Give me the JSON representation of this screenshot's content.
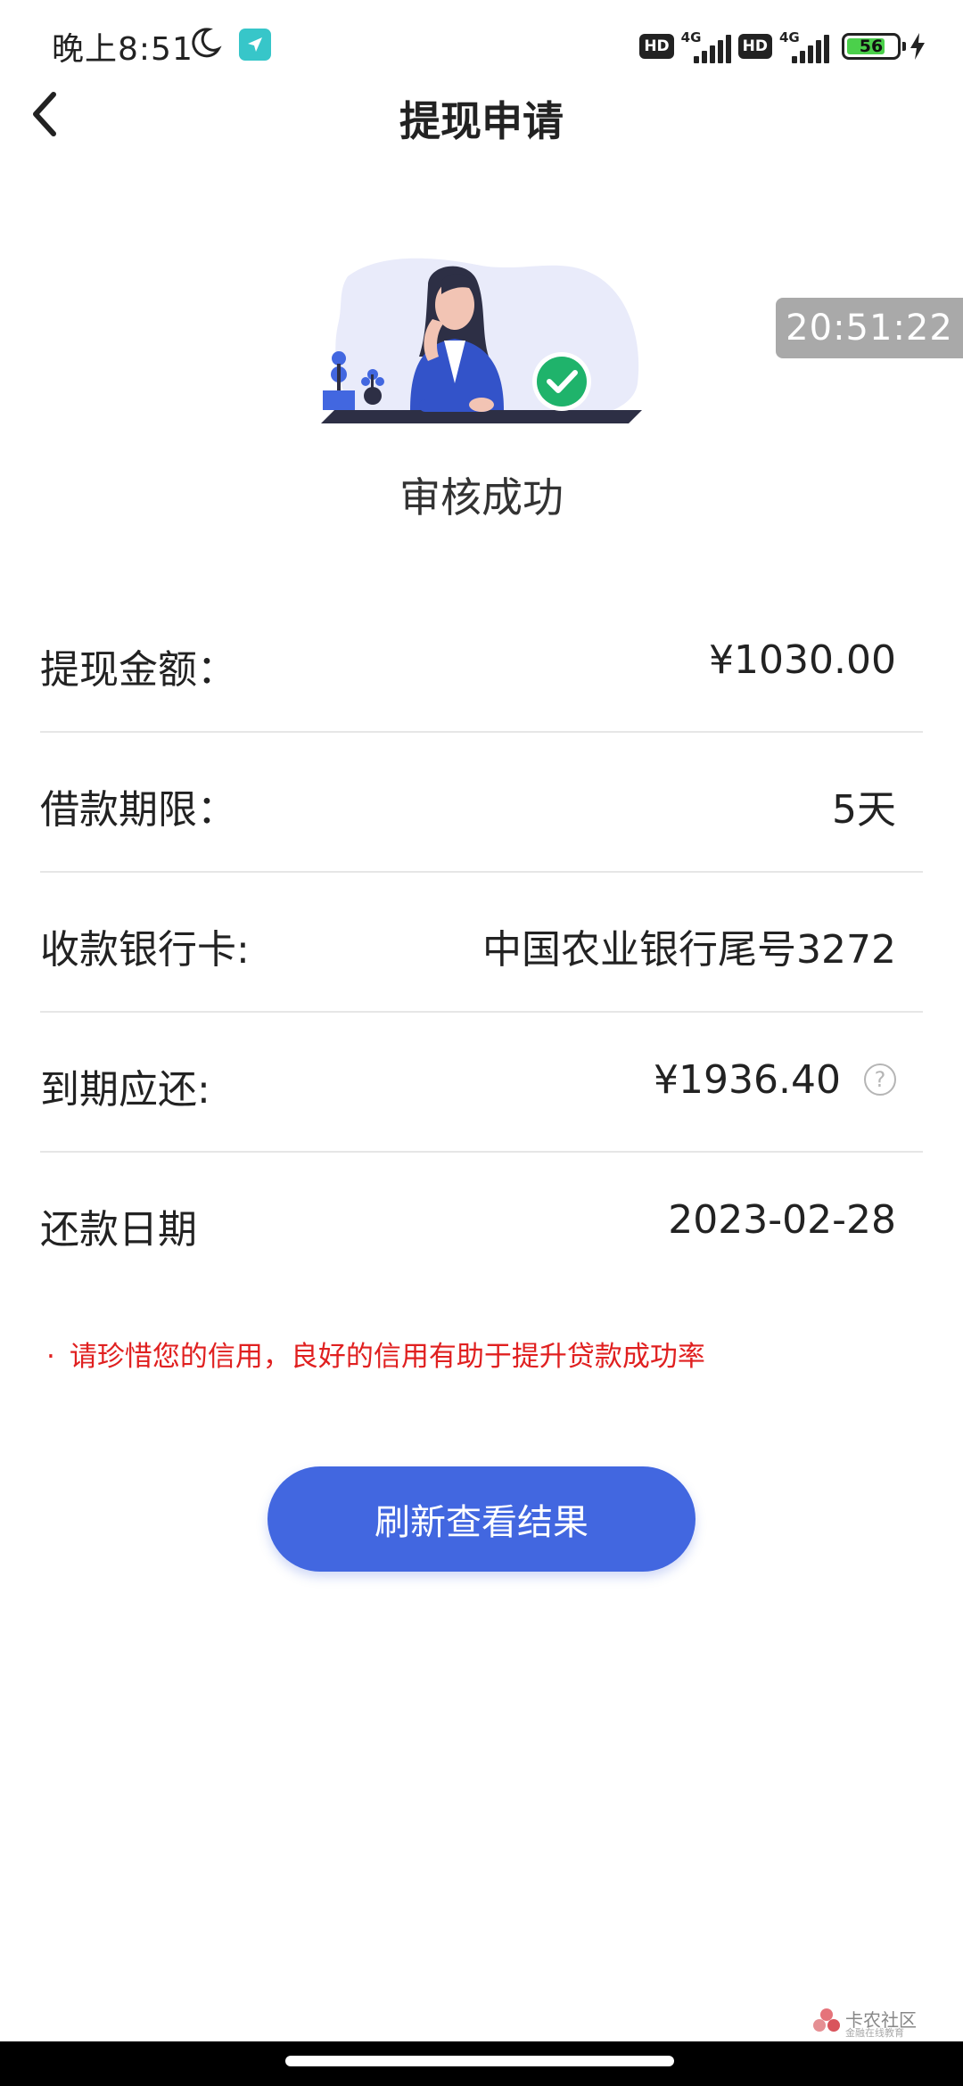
{
  "status_bar": {
    "time": "晚上8:51",
    "hd1": "HD",
    "net1": "4G",
    "hd2": "HD",
    "net2": "4G",
    "battery": "56"
  },
  "header": {
    "title": "提现申请"
  },
  "result": {
    "status": "审核成功",
    "timestamp": "20:51:22"
  },
  "details": [
    {
      "label": "提现金额：",
      "value": "¥1030.00"
    },
    {
      "label": "借款期限：",
      "value": "5天"
    },
    {
      "label": "收款银行卡:",
      "value": "中国农业银行尾号3272"
    },
    {
      "label": "到期应还:",
      "value": "¥1936.40"
    },
    {
      "label": "还款日期",
      "value": "2023-02-28"
    }
  ],
  "help_icon": "?",
  "notice": {
    "bullet": "·",
    "text": "请珍惜您的信用，良好的信用有助于提升贷款成功率"
  },
  "button": {
    "label": "刷新查看结果"
  },
  "watermark": {
    "text": "卡农社区",
    "sub": "金融在线教育"
  },
  "colors": {
    "primary": "#4267e0",
    "notice": "#e02020",
    "success": "#1fb36b"
  }
}
